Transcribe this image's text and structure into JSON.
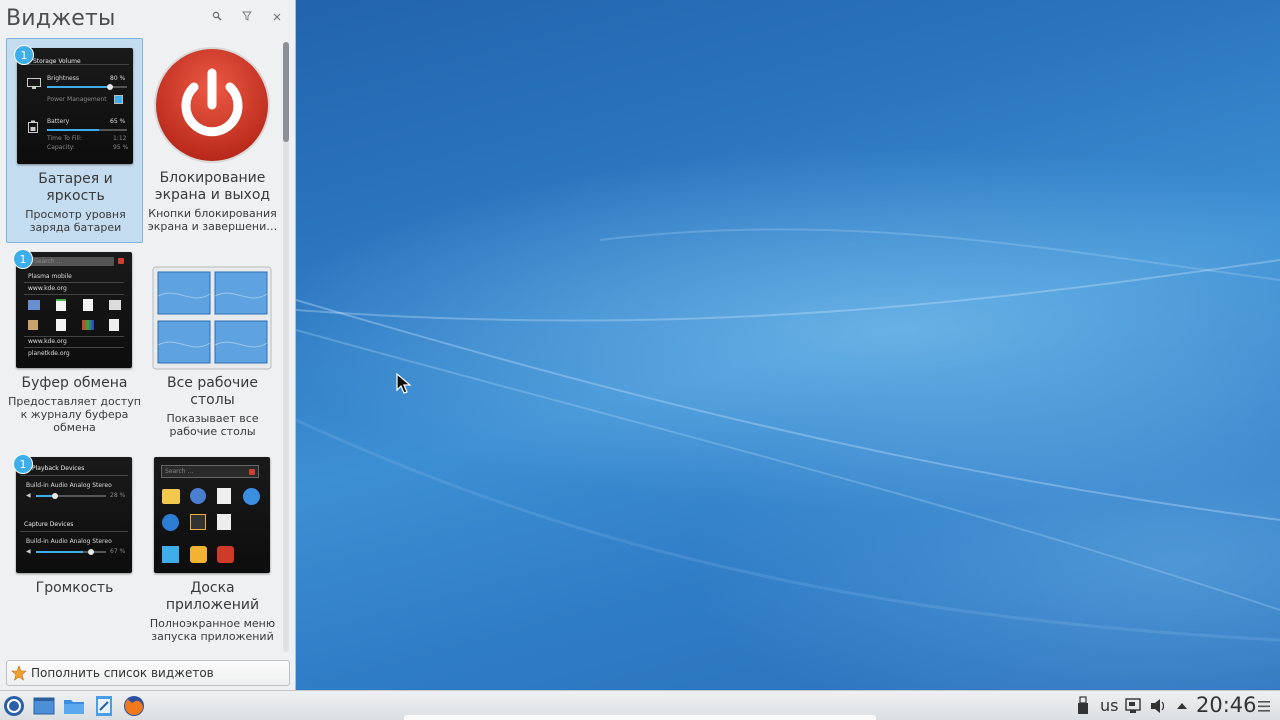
{
  "panel": {
    "title": "Виджеты",
    "search_icon": "search-icon",
    "filter_icon": "filter-icon",
    "close_icon": "close-icon",
    "more_widgets_label": "Пополнить список виджетов"
  },
  "widgets": [
    {
      "name": "Батарея и яркость",
      "desc": "Просмотр уровня заряда батареи",
      "badge": "1",
      "selected": true,
      "thumb": {
        "title": "Storage Volume",
        "brightness_label": "Brightness",
        "brightness_value": "80 %",
        "brightness_level": 0.8,
        "power_label": "Power Management",
        "battery_label": "Battery",
        "battery_value": "65 %",
        "battery_level": 0.65,
        "time_label": "Time To Fill:",
        "time_value": "1:12",
        "capacity_label": "Capacity:",
        "capacity_value": "95 %"
      }
    },
    {
      "name": "Блокирование экрана и выход",
      "desc": "Кнопки блокирования экрана и завершени…",
      "badge": "",
      "selected": false,
      "icon": "power-icon"
    },
    {
      "name": "Буфер обмена",
      "desc": "Предоставляет доступ к журналу буфера обмена",
      "badge": "1",
      "selected": false,
      "thumb": {
        "search": "Search ...",
        "item1": "Plasma mobile",
        "item2": "www.kde.org",
        "item3": "www.kde.org",
        "item4": "planetkde.org"
      }
    },
    {
      "name": "Все рабочие столы",
      "desc": "Показывает все рабочие столы",
      "badge": "",
      "selected": false,
      "icon": "pager-icon"
    },
    {
      "name": "Громкость",
      "desc": "",
      "badge": "1",
      "selected": false,
      "thumb": {
        "playback_title": "Playback Devices",
        "playback_device": "Build-in Audio Analog Stereo",
        "playback_value": "28 %",
        "playback_level": 0.28,
        "capture_title": "Capture Devices",
        "capture_device": "Build-in Audio Analog Stereo",
        "capture_value": "67 %",
        "capture_level": 0.67
      }
    },
    {
      "name": "Доска приложений",
      "desc": "Полноэкранное меню запуска приложений",
      "badge": "",
      "selected": false,
      "thumb": {
        "search": "Search ..."
      }
    }
  ],
  "taskbar": {
    "launchers": [
      "application-launcher-icon",
      "desktop-icon",
      "file-manager-icon",
      "text-editor-icon",
      "firefox-icon"
    ],
    "keyboard_layout": "us",
    "clock": "20:46",
    "tray_icons": [
      "usb-device-icon",
      "display-icon",
      "volume-icon",
      "expand-arrow-icon",
      "menu-icon"
    ]
  },
  "colors": {
    "accent": "#3daee9",
    "selection_bg": "#c4dcef",
    "power_red": "#d03a28"
  }
}
